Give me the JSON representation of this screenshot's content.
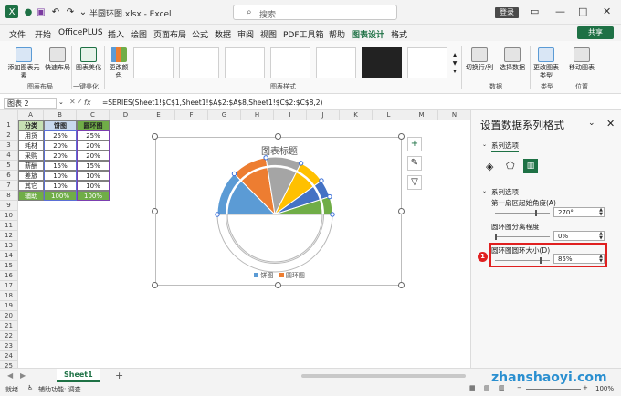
{
  "window": {
    "title": "半圆环图.xlsx - Excel",
    "search_placeholder": "搜索",
    "login_label": "登录"
  },
  "menu": {
    "tabs": [
      "文件",
      "开始",
      "OfficePLUS",
      "插入",
      "绘图",
      "页面布局",
      "公式",
      "数据",
      "审阅",
      "视图",
      "PDF工具箱",
      "帮助",
      "图表设计",
      "格式"
    ],
    "active_tab": "图表设计",
    "share_label": "共享"
  },
  "ribbon": {
    "add_element_label": "添加图表元素",
    "quick_layout_label": "快速布局",
    "beautify_label": "图表美化",
    "change_colors_label": "更改颜色",
    "switch_row_col_label": "切换行/列",
    "select_data_label": "选择数据",
    "change_type_label": "更改图表类型",
    "move_chart_label": "移动图表",
    "groups": {
      "layout": "图表布局",
      "beautify": "一键美化",
      "styles": "图表样式",
      "data": "数据",
      "type": "类型",
      "location": "位置"
    }
  },
  "formula_bar": {
    "name_box": "图表 2",
    "fx": "fx",
    "formula": "=SERIES(Sheet1!$C$1,Sheet1!$A$2:$A$8,Sheet1!$C$2:$C$8,2)"
  },
  "sheet": {
    "columns": [
      "A",
      "B",
      "C",
      "D",
      "E",
      "F",
      "G",
      "H",
      "I",
      "J",
      "K",
      "L",
      "M",
      "N"
    ],
    "rows": [
      "1",
      "2",
      "3",
      "4",
      "5",
      "6",
      "7",
      "8",
      "9",
      "10",
      "11",
      "12",
      "13",
      "14",
      "15",
      "16",
      "17",
      "18",
      "19",
      "20",
      "21",
      "22",
      "23",
      "24",
      "25"
    ],
    "table": {
      "headers": [
        "分类",
        "饼图",
        "圆环图"
      ],
      "data": [
        [
          "用货",
          "25%",
          "25%"
        ],
        [
          "耗材",
          "20%",
          "20%"
        ],
        [
          "采购",
          "20%",
          "20%"
        ],
        [
          "薪酬",
          "15%",
          "15%"
        ],
        [
          "差旅",
          "10%",
          "10%"
        ],
        [
          "其它",
          "10%",
          "10%"
        ],
        [
          "辅助",
          "100%",
          "100%"
        ]
      ]
    }
  },
  "chart": {
    "title": "图表标题",
    "legend": [
      "饼图",
      "圆环图"
    ],
    "colors": [
      "#5b9bd5",
      "#ed7d31",
      "#a5a5a5",
      "#ffc000",
      "#4472c4",
      "#70ad47"
    ]
  },
  "chart_data": {
    "type": "pie",
    "title": "图表标题",
    "categories": [
      "用货",
      "耗材",
      "采购",
      "薪酬",
      "差旅",
      "其它",
      "辅助"
    ],
    "series": [
      {
        "name": "饼图",
        "values": [
          25,
          20,
          20,
          15,
          10,
          10,
          100
        ]
      },
      {
        "name": "圆环图",
        "values": [
          25,
          20,
          20,
          15,
          10,
          10,
          100
        ]
      }
    ],
    "first_slice_angle": 270,
    "hole_size_percent": 85,
    "legend_position": "bottom"
  },
  "panel": {
    "title": "设置数据系列格式",
    "series_options_tab": "系列选项",
    "section_label": "系列选项",
    "first_angle_label": "第一扇区起始角度(A)",
    "first_angle_value": "270°",
    "first_angle_fraction": 0.75,
    "explosion_label": "圆环图分离程度",
    "explosion_value": "0%",
    "explosion_fraction": 0.0,
    "hole_size_label": "圆环图圆环大小(D)",
    "hole_size_value": "85%",
    "hole_size_fraction": 0.85,
    "badge": "1"
  },
  "sheet_tabs": {
    "active": "Sheet1",
    "add": "+"
  },
  "status": {
    "ready": "就绪",
    "accessibility": "辅助功能: 调查",
    "zoom": "100%"
  },
  "watermark": "zhanshaoyi.com"
}
